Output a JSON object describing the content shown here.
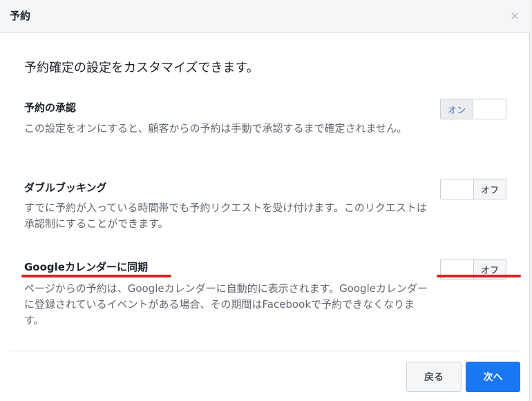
{
  "dialog": {
    "title": "予約",
    "close_glyph": "×"
  },
  "intro": "予約確定の設定をカスタマイズできます。",
  "settings": [
    {
      "title": "予約の承認",
      "description": "この設定をオンにすると、顧客からの予約は手動で承認するまで確定されません。",
      "state": "オン"
    },
    {
      "title": "ダブルブッキング",
      "description": "すでに予約が入っている時間帯でも予約リクエストを受け付けます。このリクエストは承認制にすることができます。",
      "state": "オフ"
    },
    {
      "title": "Googleカレンダーに同期",
      "description": "ページからの予約は、Googleカレンダーに自動的に表示されます。Googleカレンダーに登録されているイベントがある場合、その期間はFacebookで予約できなくなります。",
      "state": "オフ"
    }
  ],
  "footer": {
    "back_label": "戻る",
    "next_label": "次へ"
  },
  "colors": {
    "accent": "#1877f2",
    "annotation_red": "#e0201f",
    "on_text": "#4267b2"
  }
}
